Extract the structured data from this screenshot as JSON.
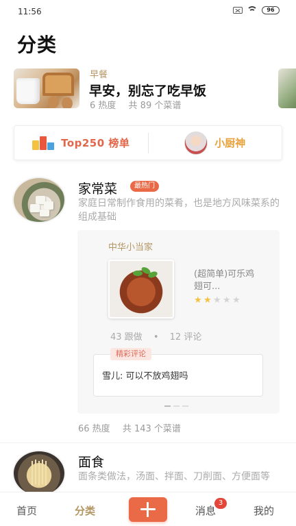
{
  "status_bar": {
    "time": "11:56",
    "battery": "96",
    "icons": [
      "sim-off-icon",
      "wifi-icon",
      "battery-icon"
    ]
  },
  "page": {
    "title": "分类"
  },
  "banner": {
    "tag": "早餐",
    "headline": "早安，别忘了吃早饭",
    "heat": "6 热度",
    "count": "共 89 个菜谱"
  },
  "ranking": {
    "top_label": "Top250 榜单",
    "chef_label": "小厨神",
    "accent_color": "#e2674a",
    "chef_color": "#e9a23b"
  },
  "categories": [
    {
      "name": "家常菜",
      "badge": "最热门",
      "description": "家庭日常制作食用的菜肴，也是地方风味菜系的组成基础",
      "heat": "66 热度",
      "count": "共 143 个菜谱",
      "featured": {
        "author": "中华小当家",
        "dish_name": "(超简单)可乐鸡翅可...",
        "rating": 2,
        "rating_max": 5,
        "follows": "43 跟做",
        "separator": "•",
        "comments": "12 评论",
        "comment_tag": "精彩评论",
        "comment_text": "雪儿: 可以不放鸡翅吗",
        "pager_total": 3,
        "pager_active": 1
      }
    },
    {
      "name": "面食",
      "description": "面条类做法，汤面、拌面、刀削面、方便面等"
    }
  ],
  "tab_bar": {
    "home": "首页",
    "category": "分类",
    "messages": "消息",
    "messages_badge": "3",
    "mine": "我的",
    "active": "category",
    "accent_color": "#ea6a47"
  }
}
